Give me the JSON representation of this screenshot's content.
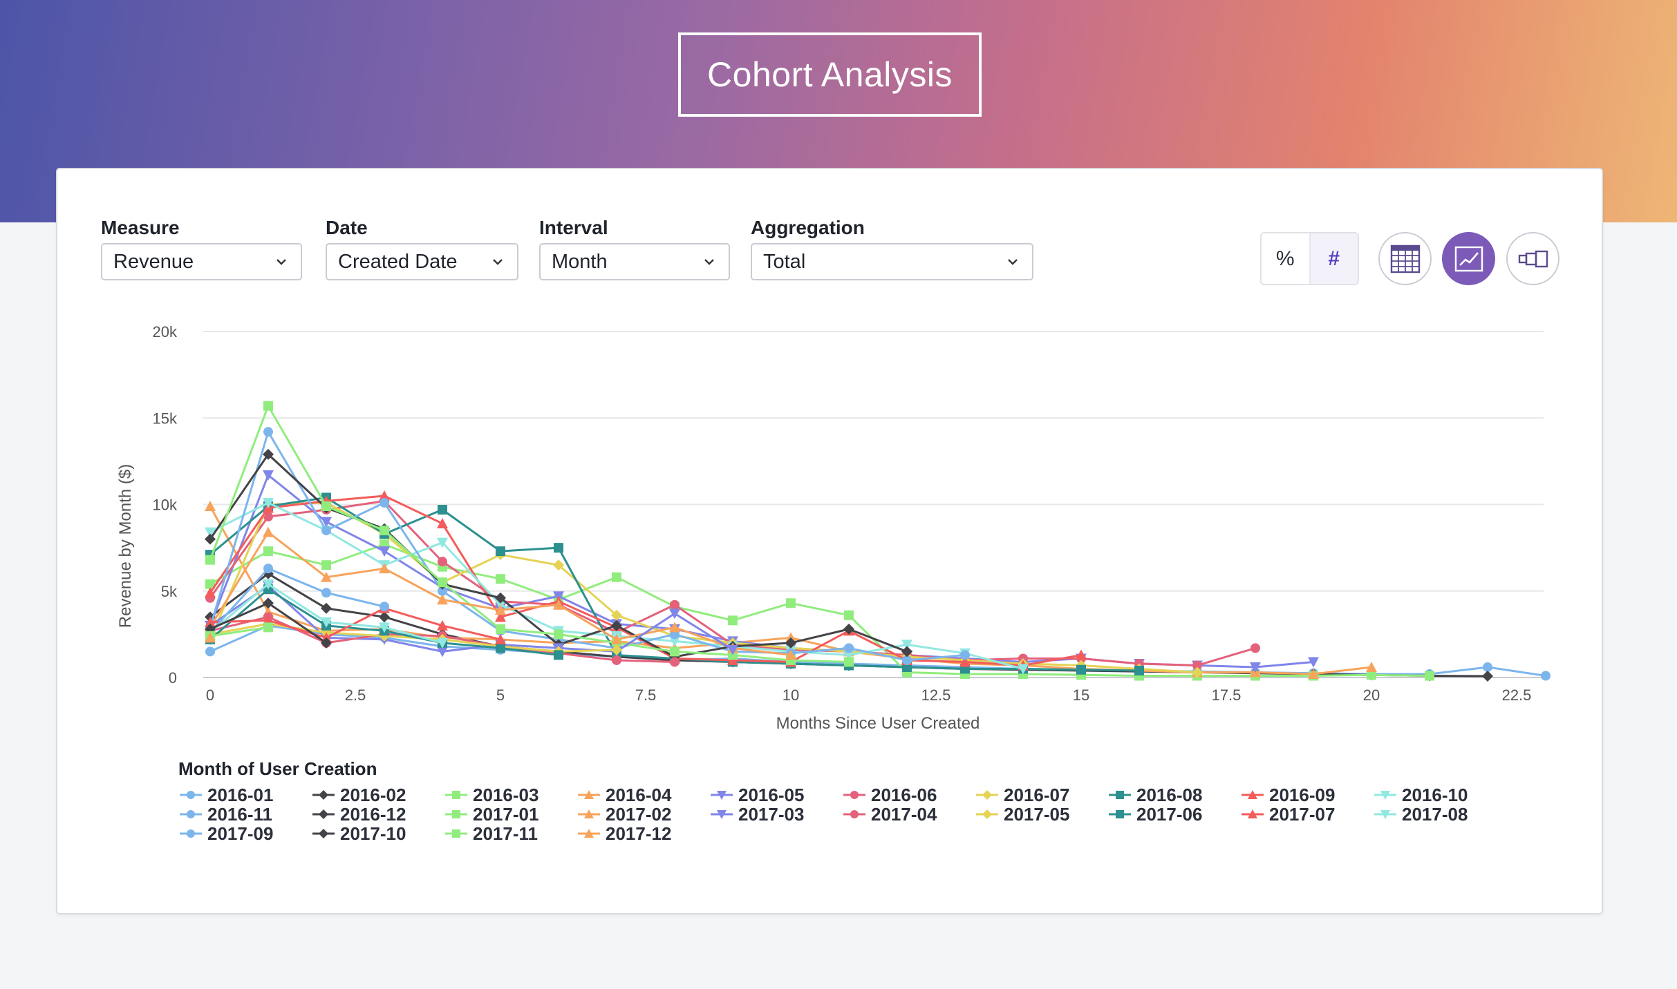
{
  "page": {
    "title": "Cohort Analysis"
  },
  "controls": {
    "measure": {
      "label": "Measure",
      "value": "Revenue"
    },
    "date": {
      "label": "Date",
      "value": "Created Date"
    },
    "interval": {
      "label": "Interval",
      "value": "Month"
    },
    "aggregation": {
      "label": "Aggregation",
      "value": "Total"
    }
  },
  "toggles": {
    "percent_label": "%",
    "number_label": "#",
    "active": "number"
  },
  "view_buttons": {
    "table_icon": "table-icon",
    "line_icon": "line-chart-icon",
    "funnel_icon": "funnel-icon",
    "active": "line"
  },
  "colors": {
    "accent": "#7c5bb8",
    "grid": "#e6e7ea"
  },
  "chart_data": {
    "type": "line",
    "xlabel": "Months Since User Created",
    "ylabel": "Revenue by Month ($)",
    "xlim": [
      0,
      23
    ],
    "ylim": [
      0,
      20000
    ],
    "x_ticks": [
      0,
      2.5,
      5,
      7.5,
      10,
      12.5,
      15,
      17.5,
      20,
      22.5
    ],
    "x_tick_labels": [
      "0",
      "2.5",
      "5",
      "7.5",
      "10",
      "12.5",
      "15",
      "17.5",
      "20",
      "22.5"
    ],
    "y_ticks": [
      0,
      5000,
      10000,
      15000,
      20000
    ],
    "y_tick_labels": [
      "0",
      "5k",
      "10k",
      "15k",
      "20k"
    ],
    "grid": true,
    "legend_title": "Month of User Creation",
    "legend_position": "bottom",
    "series": [
      {
        "name": "2016-01",
        "color": "#7cb5ec",
        "marker": "circle",
        "values": [
          1500,
          3000,
          2500,
          2300,
          1800,
          1600,
          1400,
          1200,
          1000,
          1100,
          900,
          800,
          700,
          600,
          500,
          450,
          400,
          350,
          300,
          250,
          200,
          200,
          600,
          100
        ]
      },
      {
        "name": "2016-02",
        "color": "#434348",
        "marker": "diamond",
        "values": [
          3500,
          6000,
          4000,
          3500,
          2500,
          1800,
          1500,
          1200,
          1000,
          900,
          800,
          700,
          600,
          500,
          450,
          400,
          350,
          300,
          250,
          200,
          150,
          100,
          80
        ]
      },
      {
        "name": "2016-03",
        "color": "#90ed7d",
        "marker": "square",
        "values": [
          5400,
          7300,
          6500,
          7700,
          6400,
          5700,
          4500,
          5800,
          4100,
          3300,
          4300,
          3600,
          300,
          200,
          200,
          150,
          100,
          100,
          100,
          100,
          150,
          100
        ]
      },
      {
        "name": "2016-04",
        "color": "#f7a35c",
        "marker": "triangle",
        "values": [
          9900,
          3800,
          2700,
          2800,
          2300,
          2200,
          2000,
          2100,
          1700,
          2000,
          2300,
          1500,
          1100,
          800,
          700,
          500,
          400,
          300,
          300,
          200,
          600
        ]
      },
      {
        "name": "2016-05",
        "color": "#8085e9",
        "marker": "triangle-down",
        "values": [
          3000,
          11700,
          9000,
          7300,
          5200,
          4000,
          4700,
          3100,
          2800,
          2100,
          1700,
          1500,
          1300,
          1100,
          900,
          1100,
          800,
          700,
          600,
          900
        ]
      },
      {
        "name": "2016-06",
        "color": "#e4617b",
        "marker": "circle",
        "values": [
          4600,
          9300,
          9700,
          10200,
          6700,
          4400,
          4200,
          2600,
          4200,
          1900,
          1600,
          1500,
          1300,
          1000,
          1100,
          1100,
          800,
          700,
          1700
        ]
      },
      {
        "name": "2016-07",
        "color": "#e4d354",
        "marker": "diamond",
        "values": [
          2200,
          10000,
          10100,
          8300,
          5500,
          7100,
          6500,
          3600,
          2400,
          2000,
          1700,
          1500,
          1200,
          1000,
          800,
          700,
          500,
          300
        ]
      },
      {
        "name": "2016-08",
        "color": "#2b908f",
        "marker": "square",
        "values": [
          7100,
          9900,
          10400,
          8300,
          9700,
          7300,
          7500,
          1300,
          1100,
          900,
          800,
          700,
          600,
          500,
          500,
          450,
          400
        ]
      },
      {
        "name": "2016-09",
        "color": "#f45b5b",
        "marker": "triangle",
        "values": [
          4900,
          9800,
          10200,
          10500,
          8900,
          3500,
          4400,
          2900,
          1100,
          1000,
          900,
          2700,
          1000,
          900,
          700,
          1300
        ]
      },
      {
        "name": "2016-10",
        "color": "#91e8e1",
        "marker": "triangle-down",
        "values": [
          8400,
          10100,
          8500,
          6500,
          7800,
          4200,
          2700,
          2400,
          2100,
          1800,
          1500,
          1300,
          1900,
          1400,
          500
        ]
      },
      {
        "name": "2016-11",
        "color": "#7cb5ec",
        "marker": "circle",
        "values": [
          2900,
          14200,
          8500,
          10100,
          5000,
          2700,
          2200,
          1700,
          2500,
          1500,
          1400,
          1700,
          1000,
          1300
        ]
      },
      {
        "name": "2016-12",
        "color": "#434348",
        "marker": "diamond",
        "values": [
          8000,
          12900,
          9800,
          8600,
          5400,
          4600,
          1900,
          3000,
          1200,
          1800,
          2000,
          2800,
          1500
        ]
      },
      {
        "name": "2017-01",
        "color": "#90ed7d",
        "marker": "square",
        "values": [
          6800,
          15700,
          9900,
          8500,
          5500,
          2800,
          2500,
          2000,
          1500,
          1300,
          1000,
          900
        ]
      },
      {
        "name": "2017-02",
        "color": "#f7a35c",
        "marker": "triangle",
        "values": [
          2900,
          8400,
          5800,
          6300,
          4500,
          3900,
          4200,
          2200,
          2900,
          1700,
          1300
        ]
      },
      {
        "name": "2017-03",
        "color": "#8085e9",
        "marker": "triangle-down",
        "values": [
          3000,
          5300,
          2300,
          2200,
          1500,
          1900,
          1700,
          1500,
          3700,
          1600
        ]
      },
      {
        "name": "2017-04",
        "color": "#e4617b",
        "marker": "circle",
        "values": [
          2700,
          3500,
          2000,
          2500,
          2400,
          1800,
          1400,
          1000,
          900
        ]
      },
      {
        "name": "2017-05",
        "color": "#e4d354",
        "marker": "diamond",
        "values": [
          2500,
          3100,
          2600,
          2400,
          2200,
          1800,
          1500,
          1600
        ]
      },
      {
        "name": "2017-06",
        "color": "#2b908f",
        "marker": "square",
        "values": [
          2200,
          5100,
          3000,
          2700,
          2000,
          1700,
          1300
        ]
      },
      {
        "name": "2017-07",
        "color": "#f45b5b",
        "marker": "triangle",
        "values": [
          3200,
          3300,
          2300,
          4000,
          3000,
          2200
        ]
      },
      {
        "name": "2017-08",
        "color": "#91e8e1",
        "marker": "triangle-down",
        "values": [
          2600,
          5400,
          3200,
          2900,
          2000
        ]
      },
      {
        "name": "2017-09",
        "color": "#7cb5ec",
        "marker": "circle",
        "values": [
          2600,
          6300,
          4900,
          4100
        ]
      },
      {
        "name": "2017-10",
        "color": "#434348",
        "marker": "diamond",
        "values": [
          2800,
          4300,
          2000
        ]
      },
      {
        "name": "2017-11",
        "color": "#90ed7d",
        "marker": "square",
        "values": [
          2400,
          2900
        ]
      },
      {
        "name": "2017-12",
        "color": "#f7a35c",
        "marker": "triangle",
        "values": [
          2300
        ]
      }
    ]
  }
}
